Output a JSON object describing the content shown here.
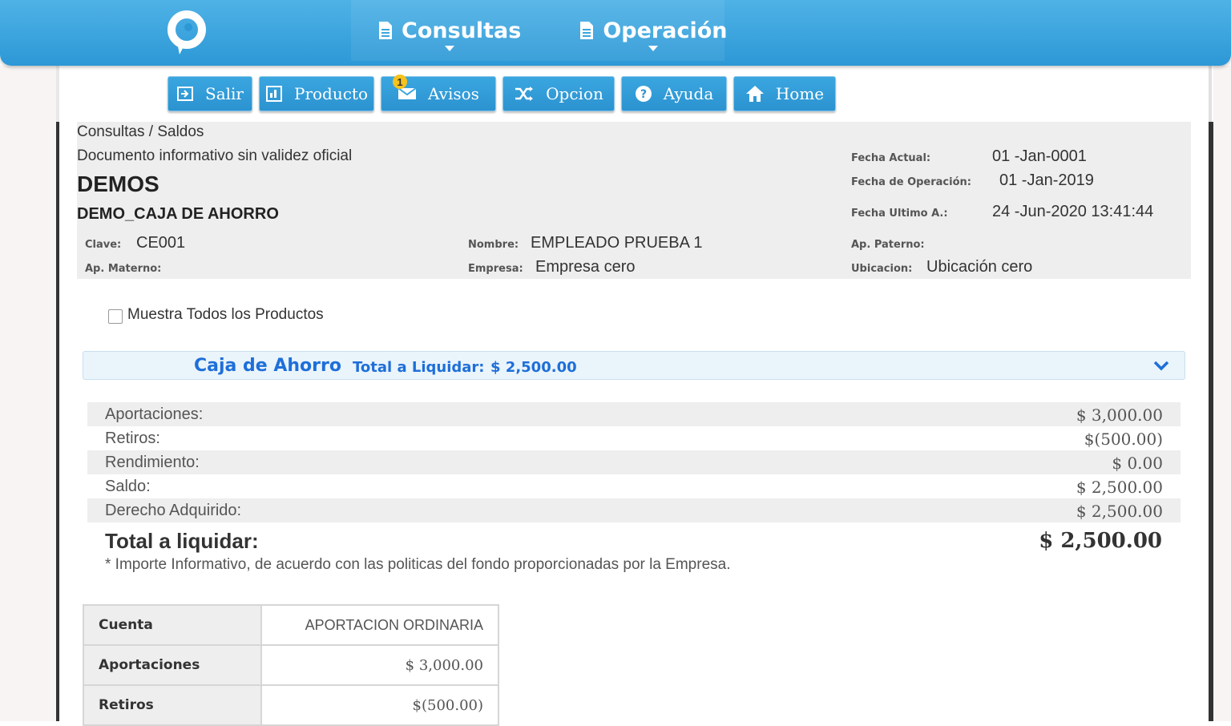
{
  "header": {
    "nav": [
      {
        "label": "Consultas"
      },
      {
        "label": "Operación"
      }
    ]
  },
  "toolbar": {
    "buttons": [
      {
        "label": "Salir",
        "icon": "exit-icon"
      },
      {
        "label": "Producto",
        "icon": "product-icon"
      },
      {
        "label": "Avisos",
        "icon": "envelope-icon",
        "badge": "1"
      },
      {
        "label": "Opcion",
        "icon": "shuffle-icon"
      },
      {
        "label": "Ayuda",
        "icon": "help-icon"
      },
      {
        "label": "Home",
        "icon": "home-icon"
      }
    ]
  },
  "info": {
    "breadcrumb": "Consultas / Saldos",
    "disclaimer": "Documento informativo sin validez oficial",
    "company": "DEMOS",
    "product": "DEMO_CAJA DE AHORRO",
    "fecha_actual_label": "Fecha Actual:",
    "fecha_actual": "01 -Jan-0001",
    "fecha_operacion_label": "Fecha de Operación:",
    "fecha_operacion": "01 -Jan-2019",
    "fecha_ultimo_label": "Fecha Ultimo A.:",
    "fecha_ultimo": "24 -Jun-2020 13:41:44",
    "clave_label": "Clave:",
    "clave": "CE001",
    "nombre_label": "Nombre:",
    "nombre": "EMPLEADO PRUEBA 1",
    "ap_paterno_label": "Ap. Paterno:",
    "ap_paterno": "",
    "ap_materno_label": "Ap. Materno:",
    "ap_materno": "",
    "empresa_label": "Empresa:",
    "empresa": "Empresa cero",
    "ubicacion_label": "Ubicacion:",
    "ubicacion": "Ubicación cero"
  },
  "options": {
    "show_all_label": "Muestra Todos los Productos",
    "show_all_checked": false
  },
  "accordion": {
    "title": "Caja de Ahorro",
    "total_label": "Total a Liquidar:",
    "total_value": "$ 2,500.00"
  },
  "summary": {
    "rows": [
      {
        "label": "Aportaciones:",
        "value": "$ 3,000.00"
      },
      {
        "label": "Retiros:",
        "value": "$(500.00)"
      },
      {
        "label": "Rendimiento:",
        "value": "$ 0.00"
      },
      {
        "label": "Saldo:",
        "value": "$ 2,500.00"
      },
      {
        "label": "Derecho Adquirido:",
        "value": "$ 2,500.00"
      }
    ],
    "total_label": "Total a liquidar:",
    "total_value": "$ 2,500.00",
    "note": "* Importe Informativo, de acuerdo con las politicas del fondo proporcionadas por la Empresa."
  },
  "detail_table": {
    "rows": [
      {
        "header": "Cuenta",
        "value": "APORTACION ORDINARIA"
      },
      {
        "header": "Aportaciones",
        "value": "$ 3,000.00"
      },
      {
        "header": "Retiros",
        "value": "$(500.00)"
      }
    ]
  },
  "colors": {
    "header_blue": "#2c98d6",
    "accent_text_blue": "#1e6fd9",
    "badge_yellow": "#f6c21b"
  }
}
